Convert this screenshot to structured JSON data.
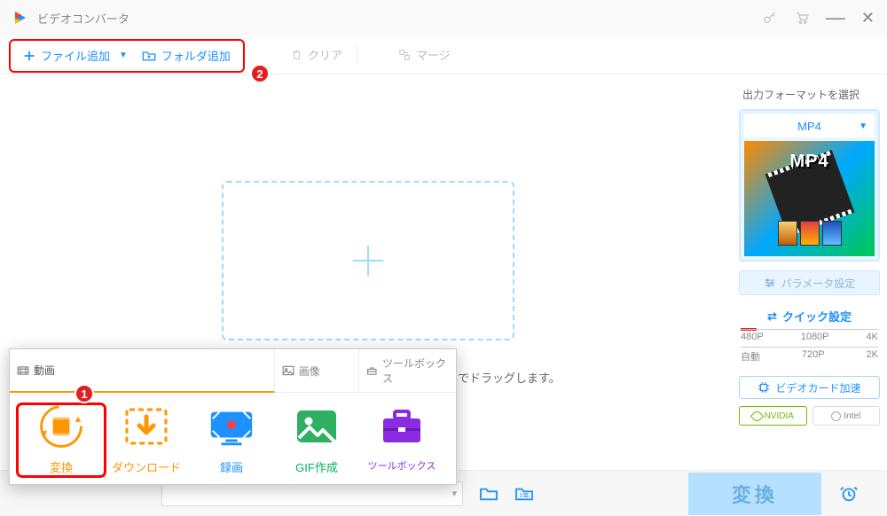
{
  "titlebar": {
    "title": "ビデオコンバータ"
  },
  "toolbar": {
    "add_file": "ファイル追加",
    "add_folder": "フォルダ追加",
    "clear": "クリア",
    "merge": "マージ"
  },
  "dropzone": {
    "hint_suffix": "こまでドラッグします。"
  },
  "sidebar": {
    "title": "出力フォーマットを選択",
    "format": "MP4",
    "thumb_label": "MP4",
    "param_btn": "パラメータ設定",
    "quick_title": "クイック設定",
    "row1": [
      "480P",
      "1080P",
      "4K"
    ],
    "row2": [
      "自動",
      "720P",
      "2K"
    ],
    "video_card": "ビデオカード加速",
    "brand1": "NVIDIA",
    "brand2": "Intel"
  },
  "bottombar": {
    "convert": "変換"
  },
  "tabs": {
    "headers": [
      "動画",
      "画像",
      "ツールボックス"
    ],
    "items": [
      {
        "label": "変換",
        "color": "c-or"
      },
      {
        "label": "ダウンロード",
        "color": "c-or"
      },
      {
        "label": "録画",
        "color": "c-bl"
      },
      {
        "label": "GIF作成",
        "color": "c-gr"
      },
      {
        "label": "ツールボックス",
        "color": "c-pu"
      }
    ]
  },
  "annotations": {
    "b1": "1",
    "b2": "2"
  }
}
